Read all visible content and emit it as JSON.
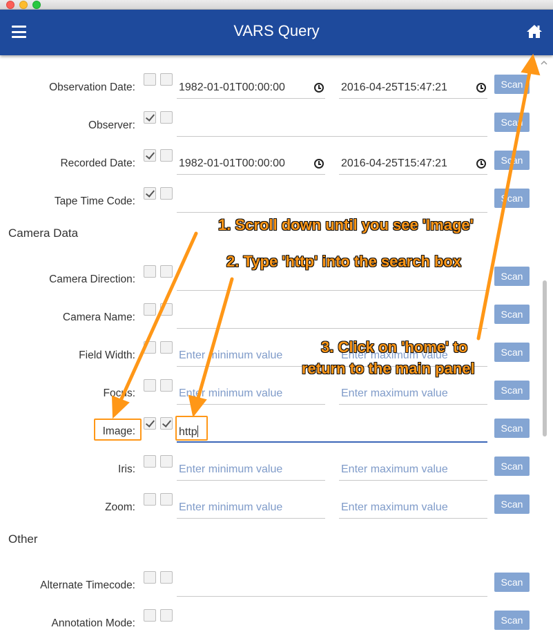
{
  "window": {
    "title": "VARS Query"
  },
  "header": {
    "menu_icon": "menu-icon",
    "home_icon": "home-icon"
  },
  "rows": {
    "observation_date": {
      "label": "Observation Date:",
      "start": "1982-01-01T00:00:00",
      "end": "2016-04-25T15:47:21",
      "scan": "Scan"
    },
    "observer": {
      "label": "Observer:",
      "scan": "Scan"
    },
    "recorded_date": {
      "label": "Recorded Date:",
      "start": "1982-01-01T00:00:00",
      "end": "2016-04-25T15:47:21",
      "scan": "Scan"
    },
    "tape_time_code": {
      "label": "Tape Time Code:",
      "scan": "Scan"
    },
    "camera_direction": {
      "label": "Camera Direction:",
      "scan": "Scan"
    },
    "camera_name": {
      "label": "Camera Name:",
      "scan": "Scan"
    },
    "field_width": {
      "label": "Field Width:",
      "min_placeholder": "Enter minimum value",
      "max_placeholder": "Enter maximum value",
      "scan": "Scan"
    },
    "focus": {
      "label": "Focus:",
      "min_placeholder": "Enter minimum value",
      "max_placeholder": "Enter maximum value",
      "scan": "Scan"
    },
    "image": {
      "label": "Image:",
      "value": "http",
      "scan": "Scan"
    },
    "iris": {
      "label": "Iris:",
      "min_placeholder": "Enter minimum value",
      "max_placeholder": "Enter maximum value",
      "scan": "Scan"
    },
    "zoom": {
      "label": "Zoom:",
      "min_placeholder": "Enter minimum value",
      "max_placeholder": "Enter maximum value",
      "scan": "Scan"
    },
    "alternate_timecode": {
      "label": "Alternate Timecode:",
      "scan": "Scan"
    },
    "annotation_mode": {
      "label": "Annotation Mode:",
      "scan": "Scan"
    }
  },
  "sections": {
    "camera_data": "Camera Data",
    "other": "Other"
  },
  "annotations": {
    "step1": "1. Scroll down until you see 'Image'",
    "step2": "2. Type 'http' into the search box",
    "step3_line1": "3. Click on 'home' to",
    "step3_line2": "return to the main panel"
  },
  "colors": {
    "header": "#1e4a9c",
    "scan_button": "#84a5d3",
    "annotation": "#ff9717",
    "placeholder": "#7f9bc9"
  }
}
